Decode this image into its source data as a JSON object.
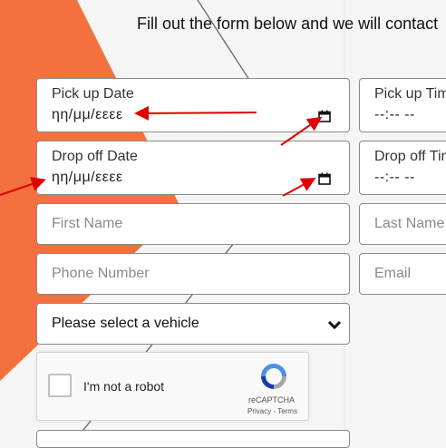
{
  "heading": "Fill out the form below and we will contact",
  "pickup_date": {
    "label": "Pick up Date",
    "value": "ηη/μμ/εεεε"
  },
  "pickup_time": {
    "label": "Pick up Tim",
    "value": "--:-- --"
  },
  "dropoff_date": {
    "label": "Drop off Date",
    "value": "ηη/μμ/εεεε"
  },
  "dropoff_time": {
    "label": "Drop off Tim",
    "value": "--:-- --"
  },
  "first_name": {
    "placeholder": "First Name"
  },
  "last_name": {
    "placeholder": "Last Name"
  },
  "phone": {
    "placeholder": "Phone Number"
  },
  "email": {
    "placeholder": "Email"
  },
  "vehicle_select": {
    "value": "Please select a vehicle"
  },
  "captcha": {
    "text": "I'm not a robot",
    "brand": "reCAPTCHA",
    "links": "Privacy - Terms"
  },
  "colors": {
    "accent": "#f4703f",
    "annotation_arrow": "#e00000",
    "recaptcha_blue": "#4a90e2",
    "recaptcha_gray": "#a6a6a6"
  },
  "icons": [
    "calendar-icon",
    "chevron-down-icon",
    "recaptcha-logo-icon"
  ]
}
